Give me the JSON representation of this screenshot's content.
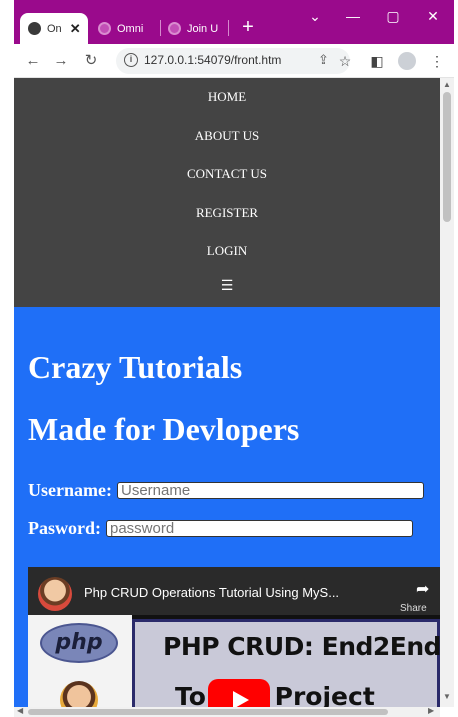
{
  "browser": {
    "tabs": [
      {
        "label": "On",
        "active": true
      },
      {
        "label": "Omni",
        "active": false
      },
      {
        "label": "Join U",
        "active": false
      }
    ],
    "new_tab": "+",
    "url": "127.0.0.1:54079/front.htm",
    "tabstrip_color": "#9a0a8c"
  },
  "nav": {
    "items": [
      "HOME",
      "ABOUT US",
      "CONTACT US",
      "REGISTER",
      "LOGIN"
    ],
    "menu_glyph": "☰",
    "background": "#444444"
  },
  "hero": {
    "title": "Crazy Tutorials",
    "subtitle": "Made for Devlopers",
    "background": "#1f6ff7",
    "username_label": "Username:",
    "username_placeholder": "Username",
    "password_label": "Pasword:",
    "password_placeholder": "password"
  },
  "video": {
    "title": "Php CRUD Operations Tutorial Using MyS...",
    "share_label": "Share",
    "logo_text": "php",
    "banner_line1": "PHP CRUD: End2End",
    "banner_line2": "To      List Project"
  }
}
